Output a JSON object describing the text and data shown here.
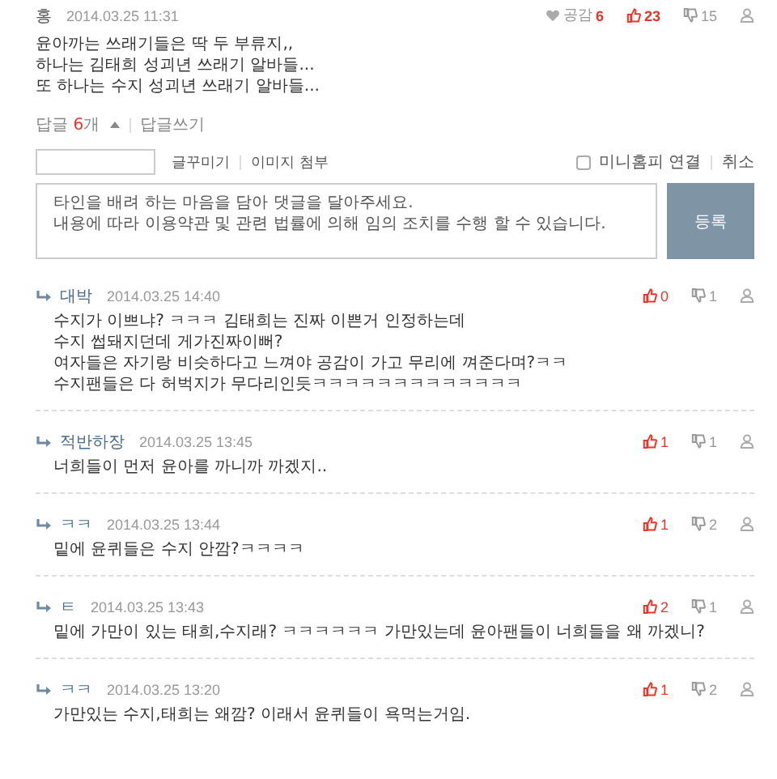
{
  "comment": {
    "author": "홍",
    "date": "2014.03.25 11:31",
    "empathy_label": "공감",
    "empathy_count": "6",
    "up": "23",
    "down": "15",
    "lines": [
      "윤아까는 쓰래기들은 딱 두 부류지,,",
      "하나는 김태희 성괴년 쓰래기 알바들...",
      "또 하나는 수지 성괴년 쓰래기 알바들..."
    ]
  },
  "reply_bar": {
    "label": "답글",
    "count": "6",
    "unit": "개",
    "expanded": true,
    "write": "답글쓰기"
  },
  "compose": {
    "tools": [
      "글꾸미기",
      "이미지 첨부"
    ],
    "minihompy": {
      "label": "미니홈피 연결",
      "checked": false
    },
    "cancel": "취소",
    "placeholder": "타인을 배려 하는 마음을 담아 댓글을 달아주세요.\n내용에 따라 이용약관 및 관련 법률에 의해 임의 조치를 수행 할 수 있습니다.",
    "submit": "등록"
  },
  "replies": [
    {
      "author": "대박",
      "date": "2014.03.25 14:40",
      "up": "0",
      "down": "1",
      "lines": [
        "수지가 이쁘냐? ㅋㅋㅋ 김태희는 진짜 이쁜거 인정하는데",
        "수지 썹돼지던데 게가진짜이뻐?",
        "여자들은 자기랑 비슷하다고 느껴야 공감이 가고 무리에 껴준다며?ㅋㅋ",
        "수지팬들은 다 허벅지가 무다리인듯ㅋㅋㅋㅋㅋㅋㅋㅋㅋㅋㅋㅋㅋ"
      ]
    },
    {
      "author": "적반하장",
      "date": "2014.03.25 13:45",
      "up": "1",
      "down": "1",
      "lines": [
        "너희들이 먼저 윤아를 까니까 까겠지.."
      ]
    },
    {
      "author": "ㅋㅋ",
      "date": "2014.03.25 13:44",
      "up": "1",
      "down": "2",
      "lines": [
        "밑에 윤퀴들은 수지 안깜?ㅋㅋㅋㅋ"
      ]
    },
    {
      "author": "ㅌ",
      "date": "2014.03.25 13:43",
      "up": "2",
      "down": "1",
      "lines": [
        "밑에 가만이 있는 태희,수지래? ㅋㅋㅋㅋㅋㅋ 가만있는데 윤아팬들이 너희들을 왜 까겠니?"
      ]
    },
    {
      "author": "ㅋㅋ",
      "date": "2014.03.25 13:20",
      "up": "1",
      "down": "2",
      "lines": [
        "가만있는 수지,태희는 왜깜? 이래서 윤퀴들이 욕먹는거임."
      ]
    }
  ]
}
